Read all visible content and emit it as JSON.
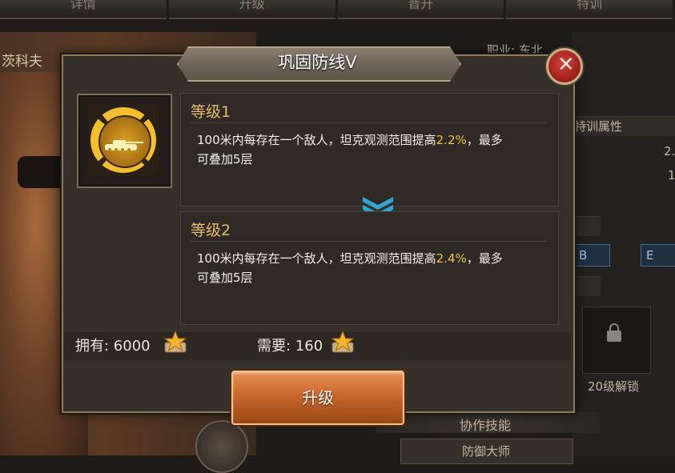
{
  "background": {
    "tabs": [
      "详情",
      "升级",
      "晋升",
      "特训"
    ],
    "officer_name": "茨科夫",
    "profession": "职业: 东北",
    "training_attr": "特训属性",
    "value_1": "2.",
    "value_2": "1",
    "button_b": "B",
    "button_e": "E",
    "unlock_text": "20级解锁",
    "coop_skill": "协作技能",
    "defense_master": "防御大师"
  },
  "dialog": {
    "title": "巩固防线V",
    "close_icon": "close-icon",
    "skill_icon": "tank-target-icon",
    "level1": {
      "title": "等级1",
      "desc_pre": "100米内每存在一个敌人，坦克观测范围提高",
      "value": "2.2%",
      "desc_mid": "，最多",
      "desc_post": "可叠加5层"
    },
    "level2": {
      "title": "等级2",
      "desc_pre": "100米内每存在一个敌人，坦克观测范围提高",
      "value": "2.4%",
      "desc_mid": "，最多",
      "desc_post": "可叠加5层"
    },
    "owned": "拥有: 6000",
    "required": "需要: 160",
    "medal_icon": "star-medal-icon",
    "upgrade_label": "升级"
  },
  "colors": {
    "highlight": "#f0c04a",
    "level_title": "#e7b96a",
    "button": "#c8672c"
  }
}
